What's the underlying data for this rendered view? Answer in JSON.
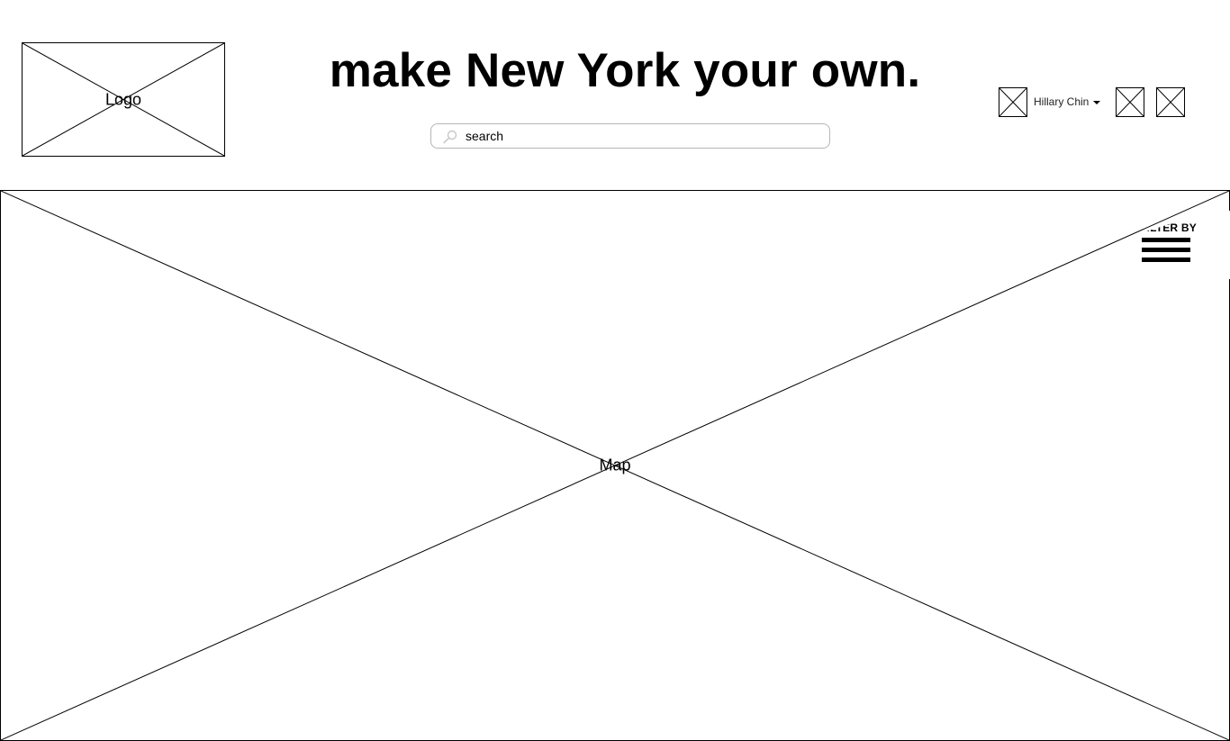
{
  "header": {
    "logo": {
      "label": "Logo"
    },
    "tagline": "make New York your own.",
    "search": {
      "value": "",
      "placeholder": "search",
      "icon": "search-icon"
    },
    "user": {
      "name": "Hillary Chin",
      "menu_icon": "chevron-down-icon"
    }
  },
  "map": {
    "label": "Map",
    "filter": {
      "label": "FILTER BY",
      "icon": "menu-icon"
    }
  }
}
